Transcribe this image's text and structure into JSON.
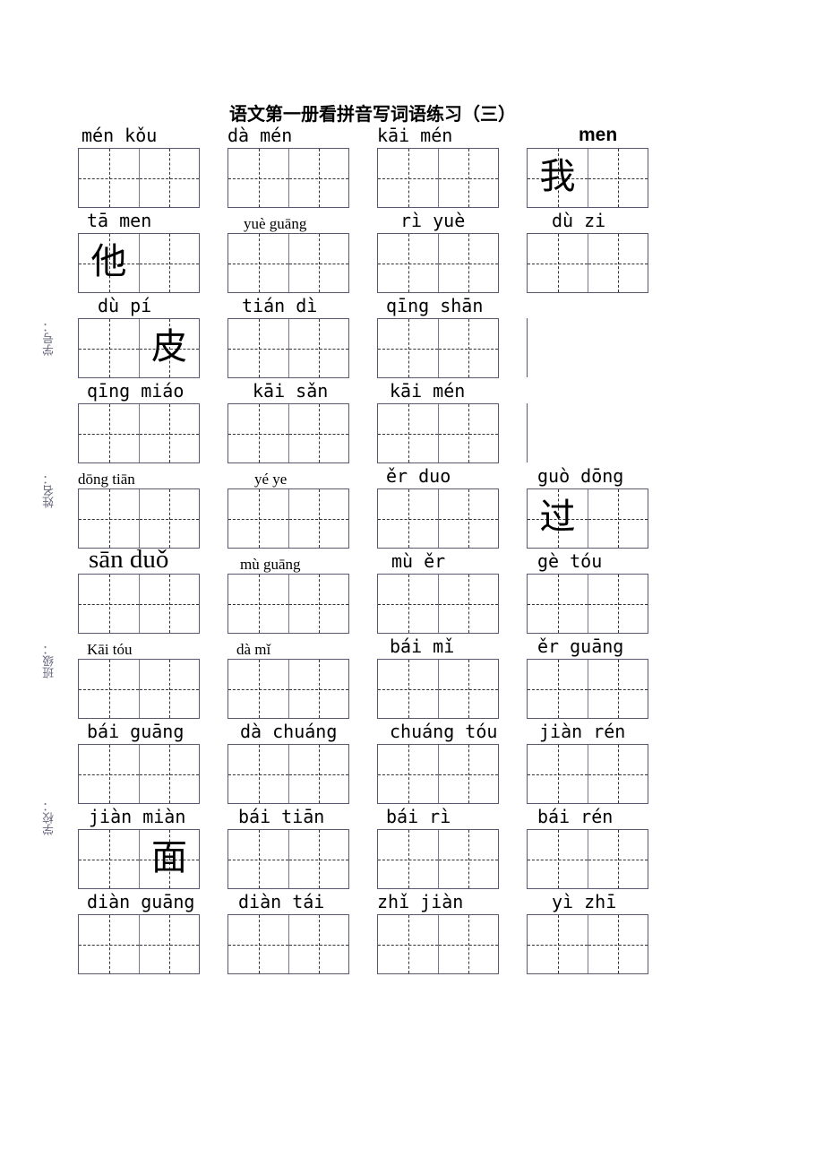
{
  "title": "语文第一册看拼音写词语练习（三）",
  "side_labels": [
    "学号：",
    "姓名：",
    "班级：",
    "学校："
  ],
  "rows": [
    [
      {
        "pinyin": "mén kǒu",
        "chars": [
          "",
          ""
        ]
      },
      {
        "pinyin": "dà mén",
        "chars": [
          "",
          ""
        ]
      },
      {
        "pinyin": "kāi mén",
        "chars": [
          "",
          ""
        ]
      },
      {
        "pinyin": "men",
        "chars": [
          "我",
          ""
        ]
      }
    ],
    [
      {
        "pinyin": "tā   men",
        "chars": [
          "他",
          ""
        ]
      },
      {
        "pinyin": "yuè guāng",
        "chars": [
          "",
          ""
        ]
      },
      {
        "pinyin": "rì yuè",
        "chars": [
          "",
          ""
        ]
      },
      {
        "pinyin": "dù zi",
        "chars": [
          "",
          ""
        ]
      }
    ],
    [
      {
        "pinyin": "dù pí",
        "chars": [
          "",
          "皮"
        ]
      },
      {
        "pinyin": "tián dì",
        "chars": [
          "",
          ""
        ]
      },
      {
        "pinyin": "qīng shān",
        "chars": [
          "",
          ""
        ]
      },
      null
    ],
    [
      {
        "pinyin": "qīng miáo",
        "chars": [
          "",
          ""
        ]
      },
      {
        "pinyin": "kāi sǎn",
        "chars": [
          "",
          ""
        ]
      },
      {
        "pinyin": "kāi mén",
        "chars": [
          "",
          ""
        ]
      },
      null
    ],
    [
      {
        "pinyin": "dōng tiān",
        "chars": [
          "",
          ""
        ]
      },
      {
        "pinyin": "yé    ye",
        "chars": [
          "",
          ""
        ]
      },
      {
        "pinyin": "ěr duo",
        "chars": [
          "",
          ""
        ]
      },
      {
        "pinyin": "guò dōng",
        "chars": [
          "过",
          ""
        ]
      }
    ],
    [
      {
        "pinyin": "sān duǒ",
        "chars": [
          "",
          ""
        ]
      },
      {
        "pinyin": "mù    guāng",
        "chars": [
          "",
          ""
        ]
      },
      {
        "pinyin": "mù ěr",
        "chars": [
          "",
          ""
        ]
      },
      {
        "pinyin": "gè tóu",
        "chars": [
          "",
          ""
        ]
      }
    ],
    [
      {
        "pinyin": "Kāi    tóu",
        "chars": [
          "",
          ""
        ]
      },
      {
        "pinyin": "dà mǐ",
        "chars": [
          "",
          ""
        ]
      },
      {
        "pinyin": "bái mǐ",
        "chars": [
          "",
          ""
        ]
      },
      {
        "pinyin": "ěr guāng",
        "chars": [
          "",
          ""
        ]
      }
    ],
    [
      {
        "pinyin": "bái guāng",
        "chars": [
          "",
          ""
        ]
      },
      {
        "pinyin": "dà chuáng",
        "chars": [
          "",
          ""
        ]
      },
      {
        "pinyin": "chuáng tóu",
        "chars": [
          "",
          ""
        ]
      },
      {
        "pinyin": "jiàn rén",
        "chars": [
          "",
          ""
        ]
      }
    ],
    [
      {
        "pinyin": "jiàn miàn",
        "chars": [
          "",
          "面"
        ]
      },
      {
        "pinyin": "bái tiān",
        "chars": [
          "",
          ""
        ]
      },
      {
        "pinyin": "bái rì",
        "chars": [
          "",
          ""
        ]
      },
      {
        "pinyin": "bái rén",
        "chars": [
          "",
          ""
        ]
      }
    ],
    [
      {
        "pinyin": "diàn guāng",
        "chars": [
          "",
          ""
        ]
      },
      {
        "pinyin": "diàn tái",
        "chars": [
          "",
          ""
        ]
      },
      {
        "pinyin": "zhǐ jiàn",
        "chars": [
          "",
          ""
        ]
      },
      {
        "pinyin": "yì zhī",
        "chars": [
          "",
          ""
        ]
      }
    ]
  ]
}
